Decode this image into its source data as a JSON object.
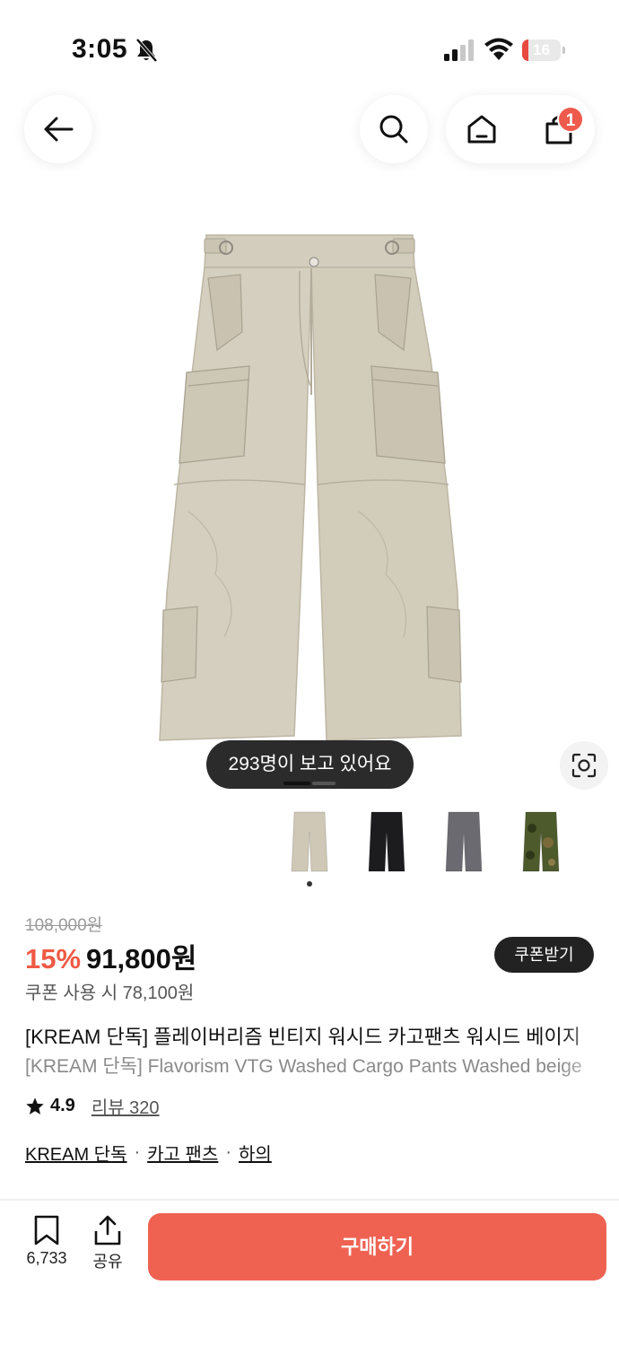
{
  "status_bar": {
    "time": "3:05",
    "battery_level": "16",
    "battery_fraction": 0.16,
    "icons": [
      "bell-slash-icon",
      "signal-icon",
      "wifi-icon",
      "battery-icon"
    ]
  },
  "nav": {
    "icons": [
      "back-arrow-icon",
      "search-icon",
      "home-icon",
      "shopping-bag-icon"
    ],
    "cart_count": "1"
  },
  "hero": {
    "viewers_text": "293명이 보고 있어요",
    "carousel_index": 1,
    "icons": [
      "image-scan-icon"
    ]
  },
  "color_options": [
    {
      "name": "beige",
      "color": "#cfc8b6"
    },
    {
      "name": "black",
      "color": "#1c1c1f"
    },
    {
      "name": "gray",
      "color": "#6b6a70"
    },
    {
      "name": "camo",
      "color": "#4d5a2c"
    }
  ],
  "pricing": {
    "original_price": "108,000원",
    "discount": "15%",
    "sale_price": "91,800원",
    "coupon_button": "쿠폰받기",
    "coupon_price": "쿠폰 사용 시 78,100원"
  },
  "product": {
    "title_ko": "[KREAM 단독] 플레이버리즘 빈티지 워시드 카고팬츠 워시드 베이지",
    "title_en": "[KREAM 단독] Flavorism VTG Washed Cargo Pants Washed beige",
    "rating": "4.9",
    "review_label": "리뷰 320"
  },
  "categories": [
    "KREAM 단독",
    "카고 팬츠",
    "하의"
  ],
  "category_separator": "·",
  "bottom_bar": {
    "bookmark_count": "6,733",
    "share_label": "공유",
    "buy_label": "구매하기"
  },
  "colors": {
    "accent": "#ef6252",
    "discount": "#ef5a45",
    "badge": "#ee5a4c",
    "dark_pill": "#2b2b2b"
  }
}
